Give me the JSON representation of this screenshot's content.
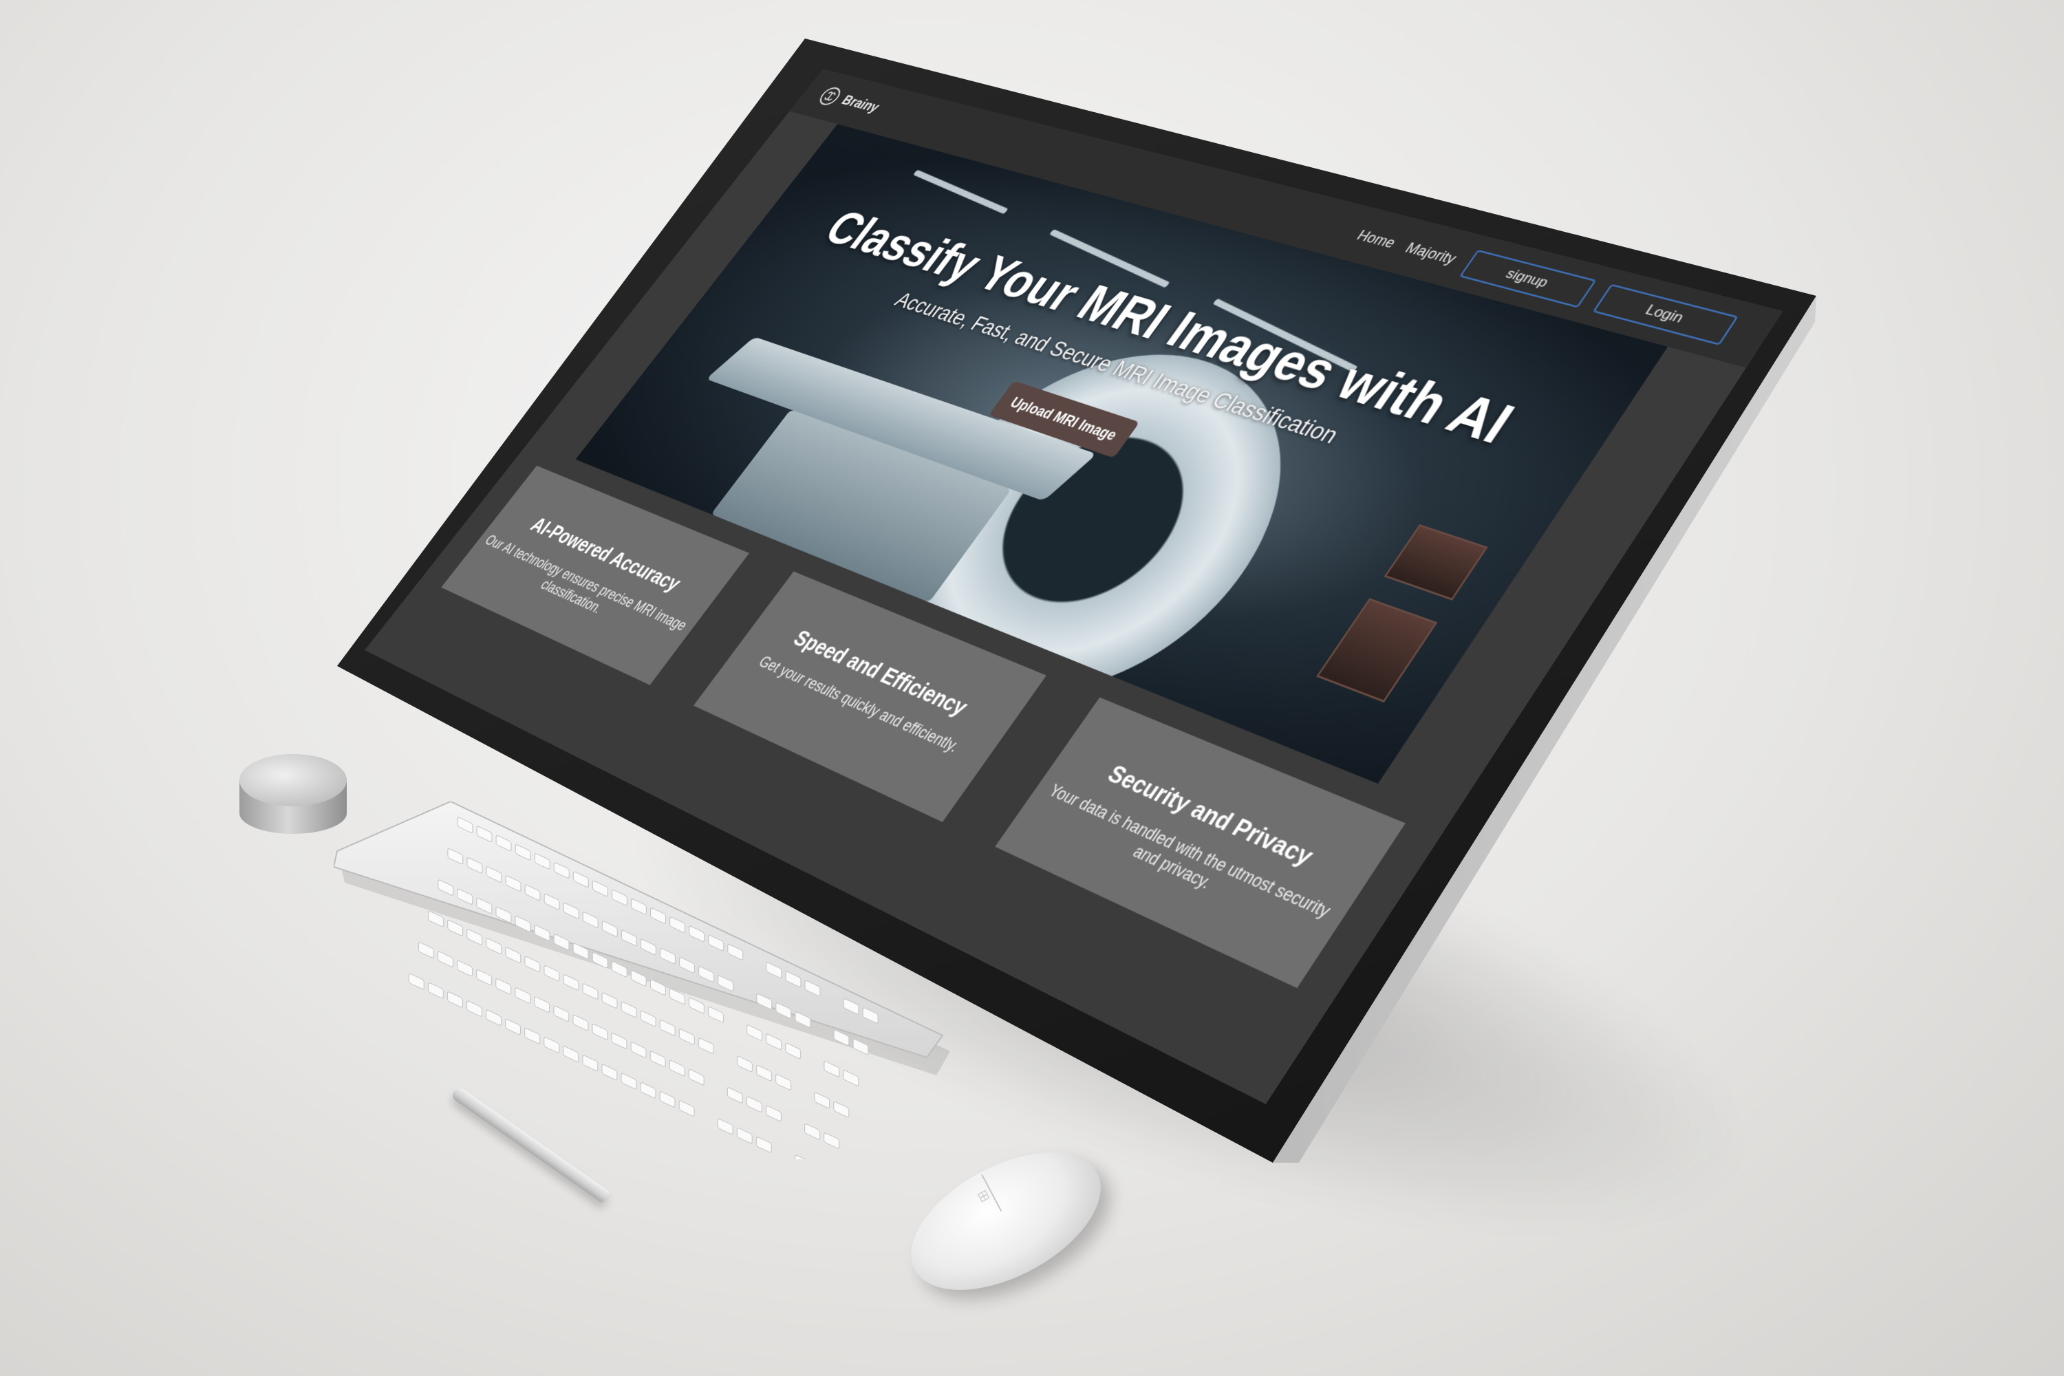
{
  "app": {
    "brand_name": "Brainy"
  },
  "nav": {
    "links": [
      "Home",
      "Majority"
    ],
    "signup_label": "signup",
    "login_label": "Login"
  },
  "hero": {
    "title": "Classify Your MRI Images with AI",
    "subtitle": "Accurate, Fast, and Secure MRI Image Classification",
    "cta_label": "Upload MRI Image"
  },
  "features": [
    {
      "title": "AI-Powered Accuracy",
      "text": "Our AI technology ensures precise MRI image classification."
    },
    {
      "title": "Speed and Efficiency",
      "text": "Get your results quickly and efficiently."
    },
    {
      "title": "Security and Privacy",
      "text": "Your data is handled with the utmost security and privacy."
    }
  ],
  "colors": {
    "page_background": "#3b3b3b",
    "navbar_background": "#2e2e2e",
    "nav_button_border": "#3d6fb4",
    "cta_background": "#5a4643",
    "feature_card_background": "#6f6f6f"
  },
  "icons": {
    "brand": "brain-icon",
    "mouse_logo": "windows-logo-icon"
  }
}
